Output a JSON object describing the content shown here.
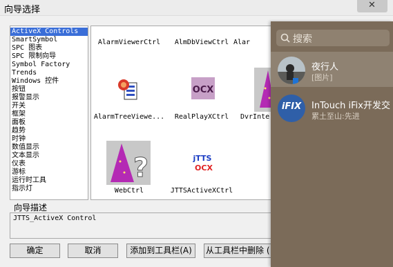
{
  "window": {
    "title": "向导选择",
    "close_glyph": "✕"
  },
  "categories": [
    "ActiveX Controls",
    "SmartSymbol",
    "SPC 图表",
    "SPC 限制向导",
    "Symbol Factory",
    "Trends",
    "Windows 控件",
    "按钮",
    "报警显示",
    "开关",
    "框架",
    "面板",
    "趋势",
    "时钟",
    "数值显示",
    "文本显示",
    "仪表",
    "游标",
    "运行时工具",
    "指示灯"
  ],
  "selected_category": 0,
  "controls": [
    {
      "label": "AlarmViewerCtrl",
      "icon": "none"
    },
    {
      "label": "AlmDbViewCtrl",
      "icon": "none"
    },
    {
      "label": "Alar",
      "icon": "none"
    },
    {
      "label": "AlarmTreeViewe...",
      "icon": "activex-control-icon"
    },
    {
      "label": "RealPlayXCtrl",
      "icon": "ocx-icon",
      "icon_text": "OCX"
    },
    {
      "label": "DvrInte",
      "icon": "wizard-icon"
    },
    {
      "label": "WebCtrl",
      "icon": "wizard-help-icon"
    },
    {
      "label": "JTTSActiveXCtrl",
      "icon": "jtts-ocx-icon",
      "icon_text_top": "jTTS",
      "icon_text_bottom": "OCX"
    }
  ],
  "description": {
    "label": "向导描述",
    "text": "JTTS_ActiveX Control"
  },
  "buttons": {
    "ok": "确定",
    "cancel": "取消",
    "add_to_toolbar": "添加到工具栏(A)",
    "remove_from_toolbar": "从工具栏中删除 ("
  },
  "chat_panel": {
    "search_placeholder": "搜索",
    "conversations": [
      {
        "name": "夜行人",
        "preview": "[图片]",
        "selected": true
      },
      {
        "name": "InTouch iFix开发交",
        "preview": "累土至山:先进",
        "selected": false,
        "avatar_text": "iFIX"
      }
    ]
  },
  "colors": {
    "accent": "#3a6ed8",
    "panel_bg": "#7b6b59",
    "selected_row": "#8f8272",
    "ifix_blue": "#2f5fa8"
  }
}
